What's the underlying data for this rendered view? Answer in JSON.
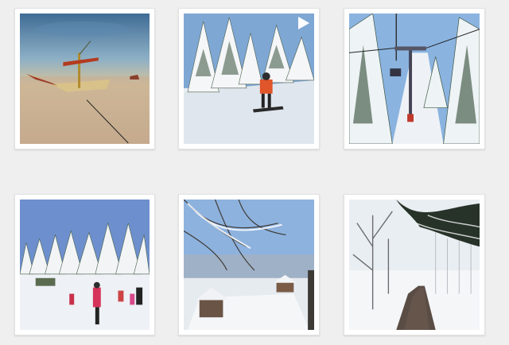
{
  "feed": {
    "posts": [
      {
        "subject": "boat-on-calm-sea-at-sunset",
        "is_video": false
      },
      {
        "subject": "snowboarder-in-snowy-forest",
        "is_video": true
      },
      {
        "subject": "ski-lift-through-snowy-trees",
        "is_video": false
      },
      {
        "subject": "skiers-on-slope-under-blue-sky",
        "is_video": false
      },
      {
        "subject": "snow-covered-village-and-trees",
        "is_video": false
      },
      {
        "subject": "snowy-road-through-misty-forest",
        "is_video": false
      }
    ]
  },
  "colors": {
    "page_background": "#efefef",
    "card_background": "#ffffff"
  },
  "icons": {
    "video_indicator": "play-icon"
  }
}
